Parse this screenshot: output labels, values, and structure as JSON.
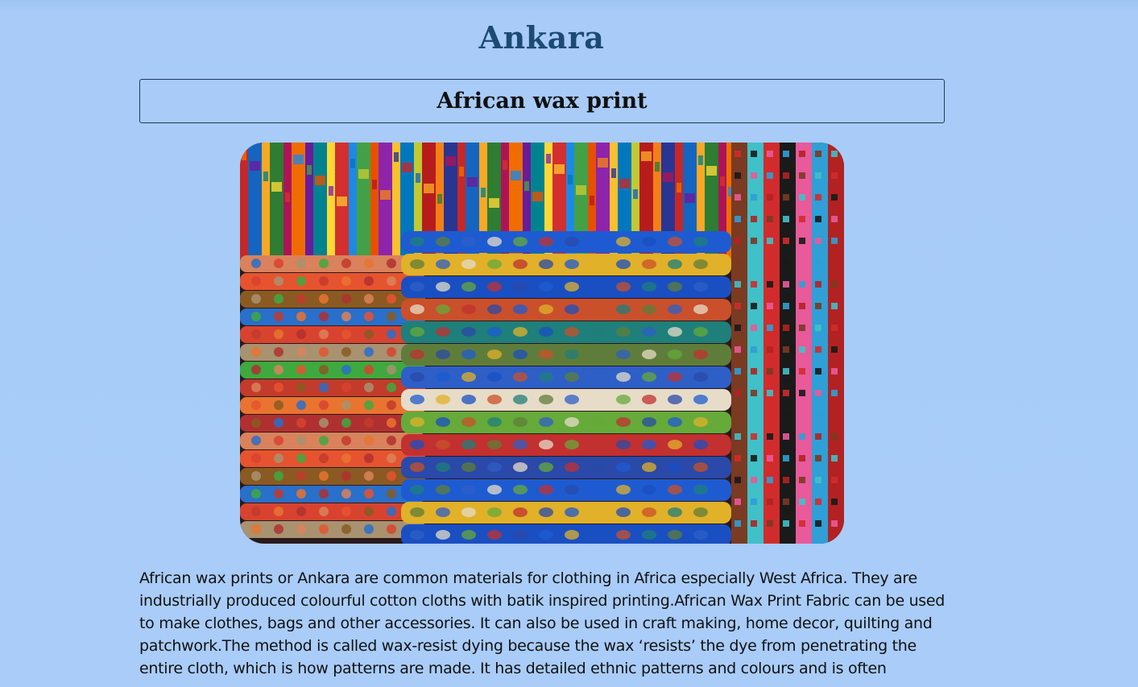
{
  "page": {
    "title": "Ankara",
    "subtitle": "African wax print",
    "description": "African wax prints or Ankara are common materials for clothing in Africa especially West Africa. They are industrially produced colourful cotton cloths with batik inspired printing.African Wax Print Fabric can be used to make clothes, bags and other accessories. It can also be used in craft making, home decor, quilting and patchwork.The method is called wax-resist dying because the wax ‘resists’ the dye from penetrating the entire cloth, which is how patterns are made. It has detailed ethnic patterns and colours and is often"
  },
  "image": {
    "subject": "stacks-of-colorful-african-wax-print-fabrics"
  },
  "colors": {
    "background": "#a9ccf8",
    "title": "#1d4a73",
    "text": "#111111",
    "border": "#213a5c"
  }
}
